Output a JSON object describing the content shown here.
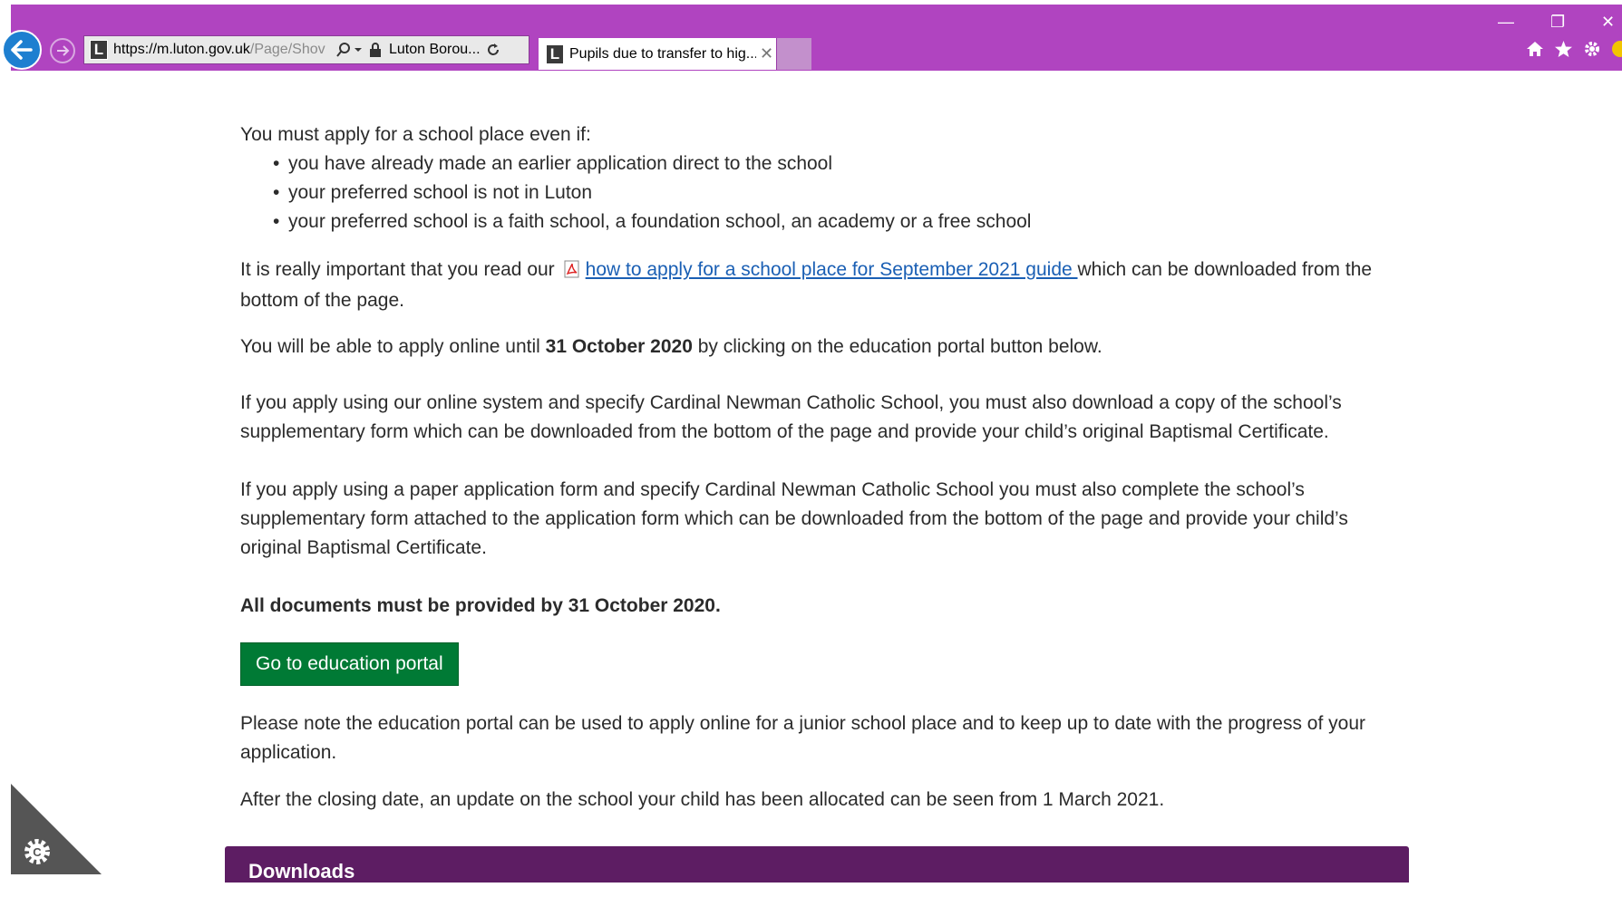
{
  "browser": {
    "url_host": "https://m.luton.gov.uk",
    "url_path": "/Page/Shov",
    "site_name": "Luton Borou...",
    "tab_title": "Pupils due to transfer to hig...",
    "favicon_letter": "L",
    "tab_close": "✕",
    "colors": {
      "chrome": "#b044c0",
      "back": "#1e7fd0"
    }
  },
  "content": {
    "intro": "You must apply for a school place even if:",
    "bullets": [
      "you have already made an earlier application direct to the school",
      "your preferred school is not in Luton",
      "your preferred school is a faith school, a foundation school, an academy or a free school"
    ],
    "read_prefix": "It is really important that you read our",
    "guide_link": "how to apply for a school place for September 2021 guide ",
    "read_suffix": "which can be downloaded from the bottom of the page.",
    "apply_prefix": "You will be able to apply online until ",
    "apply_date": "31 October 2020",
    "apply_suffix": " by clicking on the education portal button below.",
    "online_cardinal": "If you apply using our online system and specify Cardinal Newman Catholic School, you must also download a copy of the school’s supplementary form which can be downloaded from the bottom of the page and provide your child’s original Baptismal Certificate.",
    "paper_cardinal": "If you apply using a paper application form and specify Cardinal Newman Catholic School you must also complete the school’s supplementary form attached to the application form which can be downloaded from the bottom of the page and provide your child’s original Baptismal Certificate.",
    "documents_deadline": "All documents must be provided by 31 October 2020.",
    "portal_button": "Go to education portal",
    "portal_note": "Please note the education portal can be used to apply online for a junior school place and to keep up to date with the progress of your application.",
    "closing_note": "After the closing date, an update on the school your child has been allocated can be seen from 1 March 2021.",
    "downloads_heading": "Downloads"
  },
  "colors": {
    "button": "#007a35",
    "downloads_bar": "#5d1d63",
    "link": "#1a5fb4"
  }
}
